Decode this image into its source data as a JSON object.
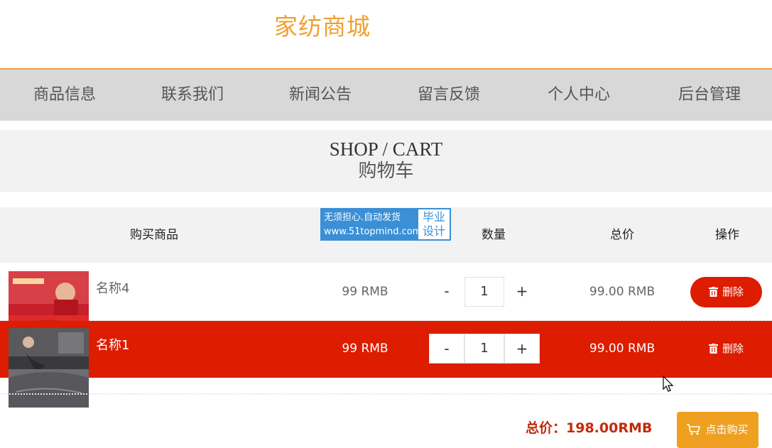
{
  "site": {
    "title": "家纺商城"
  },
  "nav": [
    {
      "label": "商品信息"
    },
    {
      "label": "联系我们"
    },
    {
      "label": "新闻公告"
    },
    {
      "label": "留言反馈"
    },
    {
      "label": "个人中心"
    },
    {
      "label": "后台管理"
    }
  ],
  "banner": {
    "title_en": "SHOP / CART",
    "title_cn": "购物车"
  },
  "watermark": {
    "line1": "无须担心.自动发货",
    "line2": "www.51topmind.com",
    "side1": "毕业",
    "side2": "设计"
  },
  "table": {
    "headers": {
      "product": "购买商品",
      "quantity": "数量",
      "total": "总价",
      "action": "操作"
    }
  },
  "cart": [
    {
      "name": "名称4",
      "price": "99 RMB",
      "qty": "1",
      "total": "99.00 RMB",
      "delete_label": "删除",
      "minus": "-",
      "plus": "+"
    },
    {
      "name": "名称1",
      "price": "99 RMB",
      "qty": "1",
      "total": "99.00 RMB",
      "delete_label": "删除",
      "minus": "-",
      "plus": "+"
    }
  ],
  "summary": {
    "total_text": "总价：198.00RMB",
    "buy_label": "点击购买"
  },
  "colors": {
    "accent": "#f0a030",
    "danger": "#dd1c00",
    "nav_bg": "#d8d8d8"
  },
  "icons": {
    "trash": "trash-icon",
    "cart": "cart-icon",
    "cursor": "mouse-cursor-icon"
  }
}
